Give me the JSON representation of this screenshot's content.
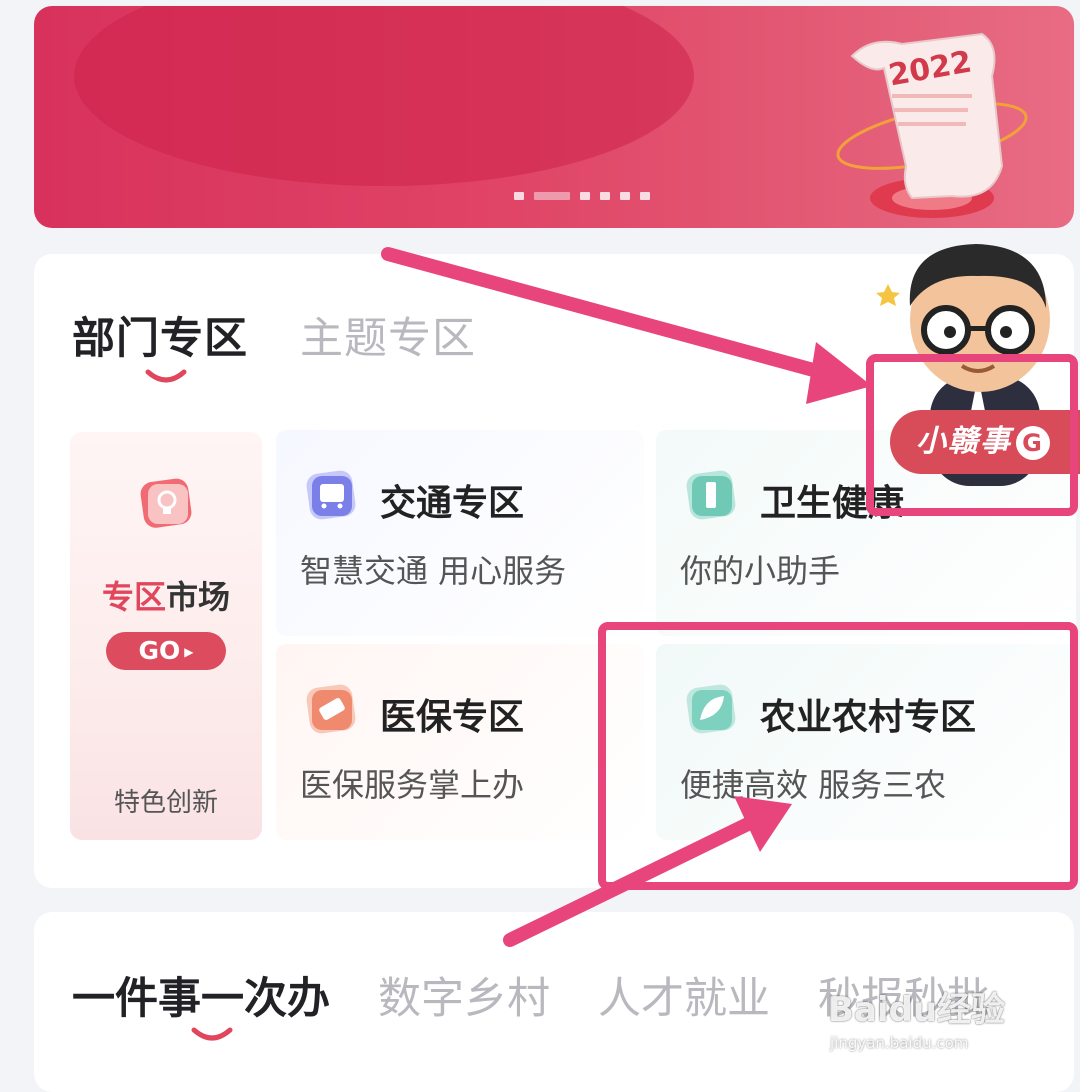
{
  "banner": {
    "year_text": "2022",
    "slide_count": 6,
    "active_slide": 2
  },
  "tabs": [
    {
      "label": "部门专区",
      "active": true
    },
    {
      "label": "主题专区",
      "active": false
    }
  ],
  "market": {
    "title_highlight": "专区",
    "title_rest": "市场",
    "button_label": "GO",
    "subtitle": "特色创新"
  },
  "tiles": [
    {
      "title": "交通专区",
      "subtitle": "智慧交通 用心服务",
      "icon": "bus-icon"
    },
    {
      "title": "卫生健康",
      "subtitle": "你的小助手",
      "icon": "health-icon"
    },
    {
      "title": "医保专区",
      "subtitle": "医保服务掌上办",
      "icon": "medical-insurance-icon"
    },
    {
      "title": "农业农村专区",
      "subtitle": "便捷高效 服务三农",
      "icon": "leaf-icon"
    }
  ],
  "mascot": {
    "badge_label": "小赣事",
    "badge_logo": "G"
  },
  "tabs2": [
    {
      "label": "一件事一次办",
      "active": true
    },
    {
      "label": "数字乡村",
      "active": false
    },
    {
      "label": "人才就业",
      "active": false
    },
    {
      "label": "秒报秒批",
      "active": false
    }
  ],
  "watermark": {
    "brand": "Baidu经验",
    "url": "jingyan.baidu.com"
  },
  "colors": {
    "accent": "#dd4b5e",
    "annotation": "#e8457c",
    "banner": "#d8325c"
  }
}
